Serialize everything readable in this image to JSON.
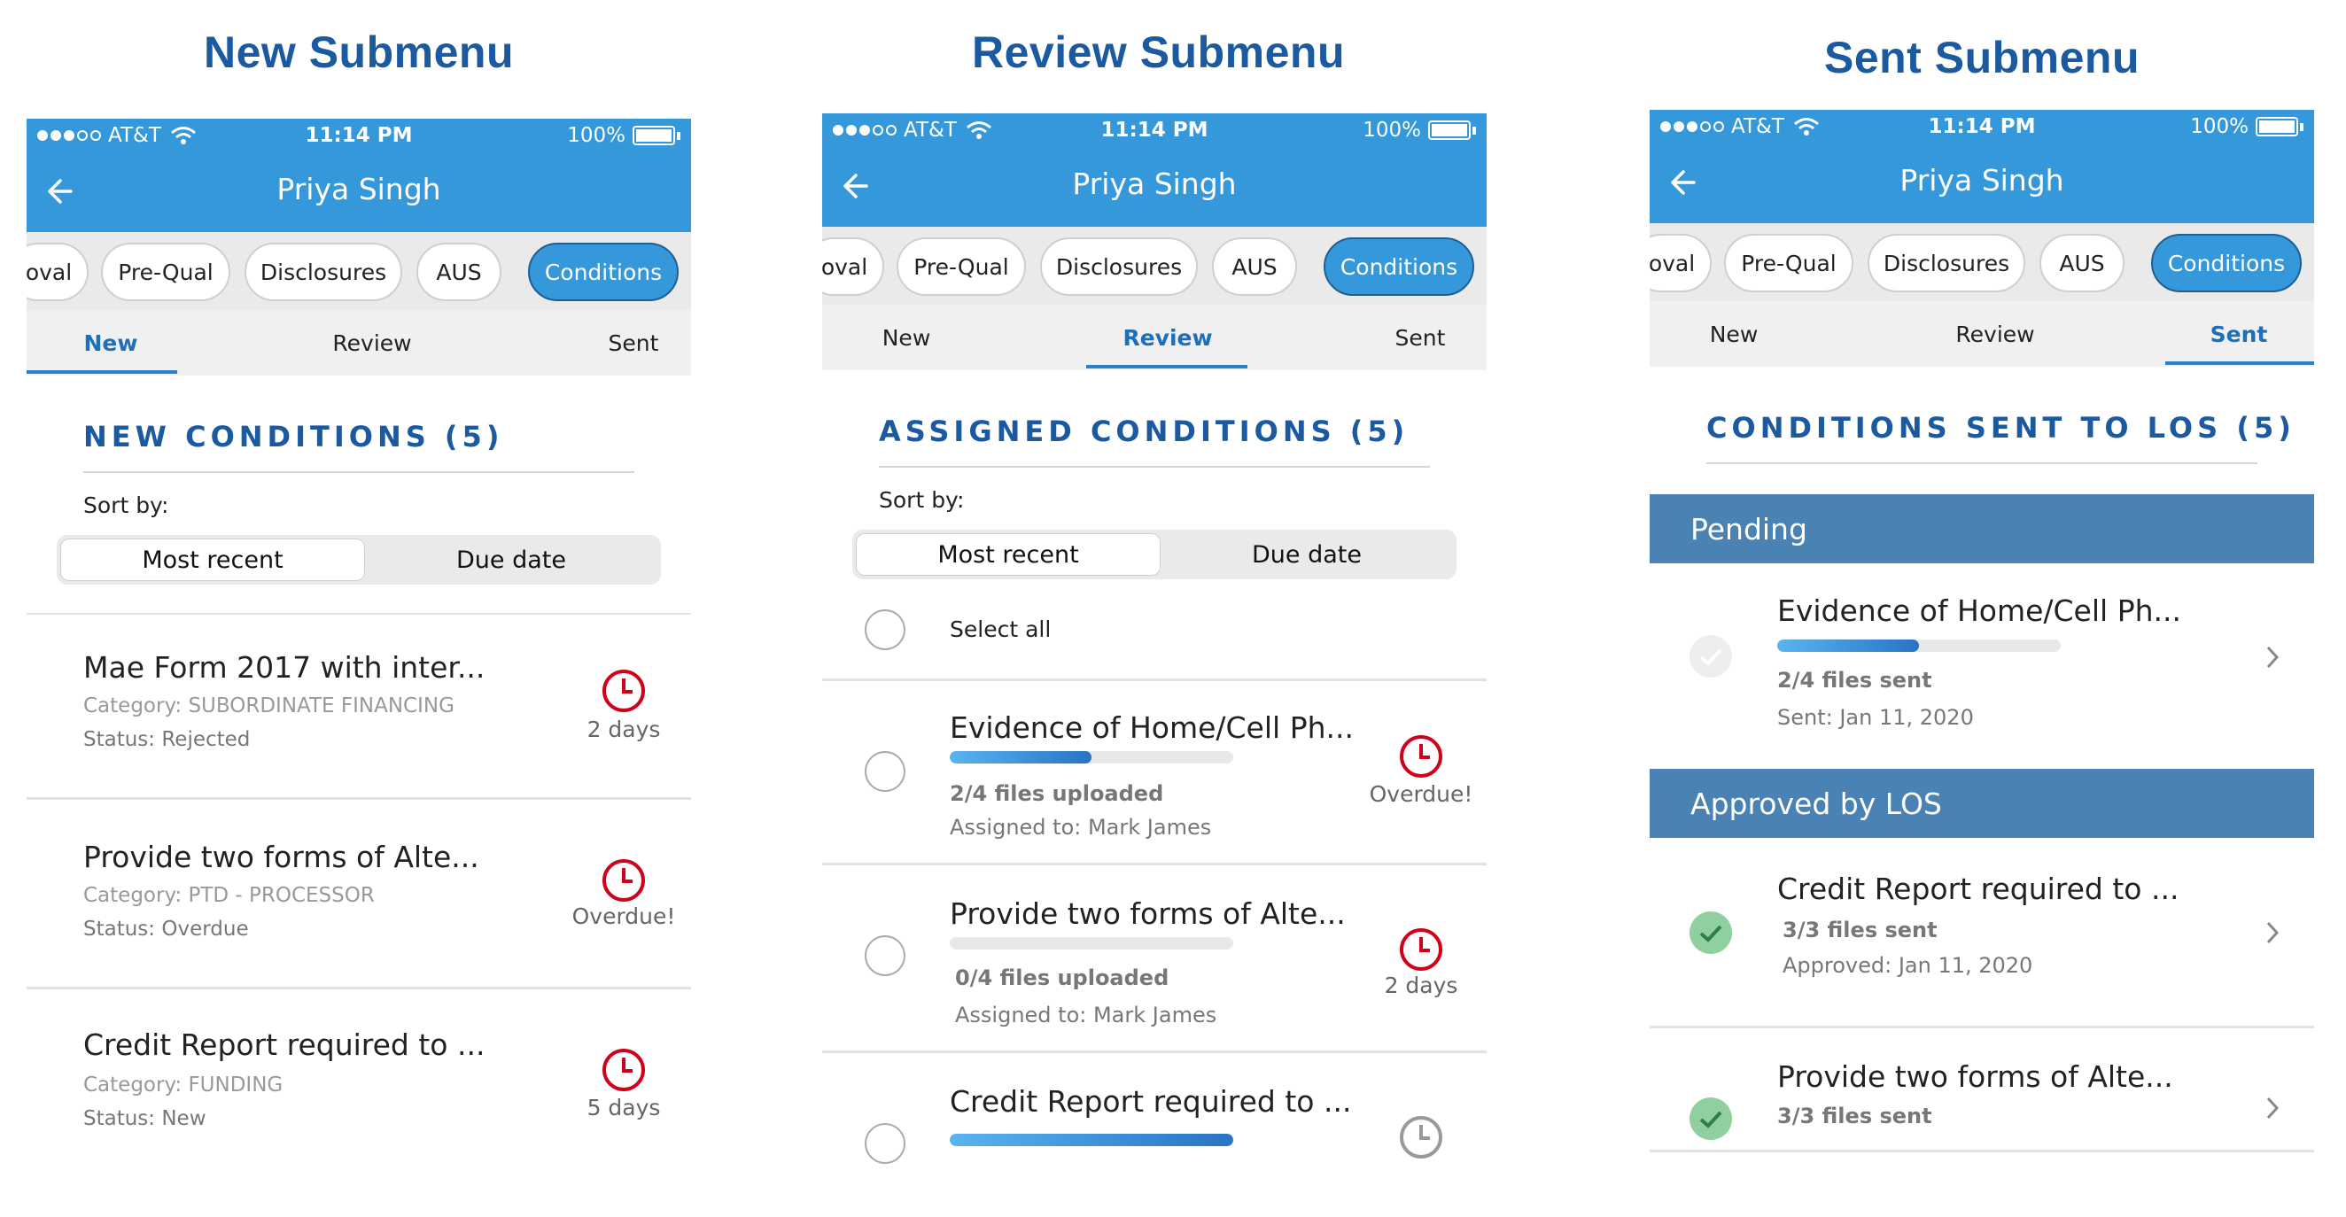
{
  "titles": {
    "new": "New Submenu",
    "review": "Review Submenu",
    "sent": "Sent Submenu"
  },
  "status_bar": {
    "carrier": "AT&T",
    "time": "11:14 PM",
    "battery": "100%"
  },
  "header": {
    "title": "Priya Singh",
    "back_icon": "arrow-left-icon"
  },
  "tabs": [
    "oval",
    "Pre-Qual",
    "Disclosures",
    "AUS",
    "Conditions"
  ],
  "active_tab": "Conditions",
  "subtabs": {
    "new": "New",
    "review": "Review",
    "sent": "Sent"
  },
  "sort": {
    "label": "Sort by:",
    "most_recent": "Most recent",
    "due_date": "Due date",
    "selected": "Most recent"
  },
  "colors": {
    "header_blue": "#3498db",
    "title_blue": "#1b5aa0",
    "group_header": "#4a82b4",
    "alert_red": "#d0021b",
    "check_green": "#8fcfa0"
  },
  "new_panel": {
    "section_title": "NEW CONDITIONS (5)",
    "items": [
      {
        "title": "Mae Form 2017 with inter...",
        "category": "Category: SUBORDINATE FINANCING",
        "status": "Status: Rejected",
        "due": "2 days"
      },
      {
        "title": "Provide two forms of Alte...",
        "category": "Category: PTD - PROCESSOR",
        "status": "Status: Overdue",
        "due": "Overdue!"
      },
      {
        "title": "Credit Report required to ...",
        "category": "Category: FUNDING",
        "status": "Status: New",
        "due": "5 days"
      }
    ]
  },
  "review_panel": {
    "section_title": "ASSIGNED CONDITIONS (5)",
    "select_all": "Select all",
    "items": [
      {
        "title": "Evidence of Home/Cell Ph...",
        "files": "2/4 files uploaded",
        "assigned": "Assigned to: Mark James",
        "due": "Overdue!",
        "progress": 0.5
      },
      {
        "title": "Provide two forms of Alte...",
        "files": "0/4 files uploaded",
        "assigned": "Assigned to: Mark James",
        "due": "2 days",
        "progress": 0
      },
      {
        "title": "Credit Report required to ...",
        "progress": 1.0
      }
    ]
  },
  "sent_panel": {
    "section_title": "CONDITIONS SENT TO LOS (5)",
    "groups": {
      "pending": "Pending",
      "approved": "Approved by LOS"
    },
    "pending_items": [
      {
        "title": "Evidence of Home/Cell Ph...",
        "files": "2/4 files sent",
        "date": "Sent: Jan 11, 2020",
        "progress": 0.5
      }
    ],
    "approved_items": [
      {
        "title": "Credit Report required to ...",
        "files": "3/3 files sent",
        "date": "Approved: Jan 11, 2020"
      },
      {
        "title": "Provide two forms of Alte...",
        "files": "3/3 files sent"
      }
    ]
  }
}
